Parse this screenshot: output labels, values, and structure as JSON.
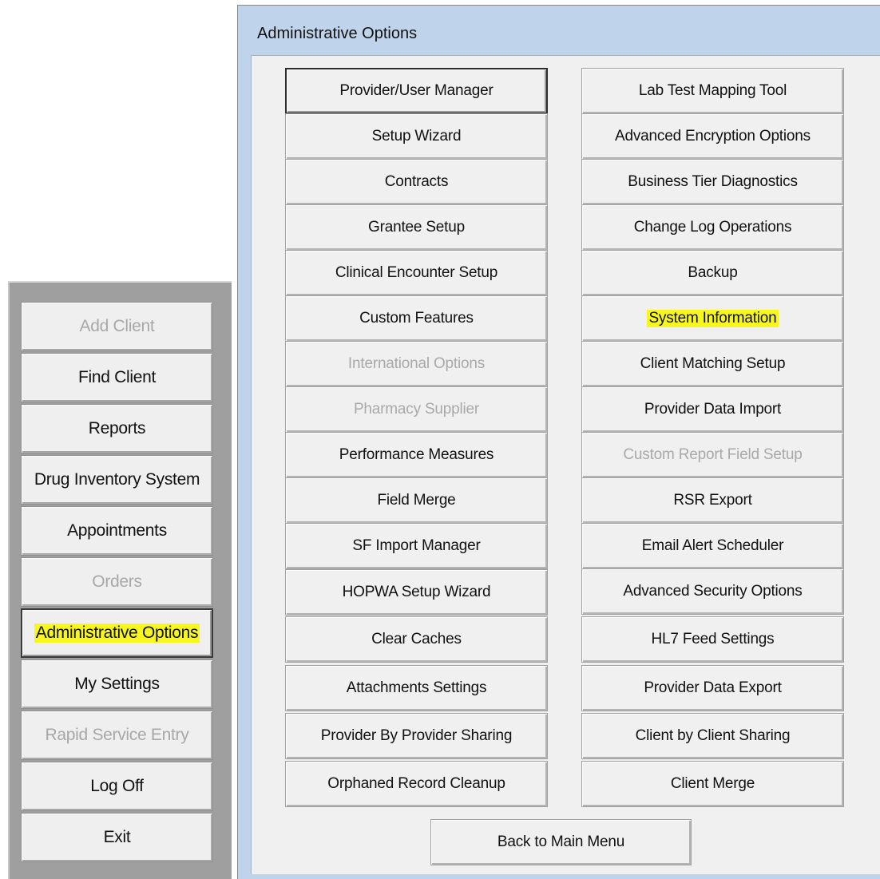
{
  "main_menu": {
    "items": [
      {
        "label": "Add Client",
        "disabled": true
      },
      {
        "label": "Find Client",
        "disabled": false
      },
      {
        "label": "Reports",
        "disabled": false
      },
      {
        "label": "Drug Inventory System",
        "disabled": false
      },
      {
        "label": "Appointments",
        "disabled": false
      },
      {
        "label": "Orders",
        "disabled": true
      },
      {
        "label": "Administrative Options",
        "disabled": false,
        "selected": true,
        "highlighted": true
      },
      {
        "label": "My Settings",
        "disabled": false
      },
      {
        "label": "Rapid Service Entry",
        "disabled": true
      },
      {
        "label": "Log Off",
        "disabled": false
      },
      {
        "label": "Exit",
        "disabled": false
      }
    ]
  },
  "admin_window": {
    "title": "Administrative Options",
    "left_column": [
      {
        "label": "Provider/User Manager",
        "disabled": false,
        "default": true
      },
      {
        "label": "Setup Wizard",
        "disabled": false
      },
      {
        "label": "Contracts",
        "disabled": false
      },
      {
        "label": "Grantee Setup",
        "disabled": false
      },
      {
        "label": "Clinical Encounter Setup",
        "disabled": false
      },
      {
        "label": "Custom Features",
        "disabled": false
      },
      {
        "label": "International Options",
        "disabled": true
      },
      {
        "label": "Pharmacy Supplier",
        "disabled": true
      },
      {
        "label": "Performance Measures",
        "disabled": false
      },
      {
        "label": "Field Merge",
        "disabled": false
      },
      {
        "label": "SF Import Manager",
        "disabled": false
      },
      {
        "label": "HOPWA Setup Wizard",
        "disabled": false
      },
      {
        "label": "Clear Caches",
        "disabled": false
      },
      {
        "label": "Attachments Settings",
        "disabled": false
      },
      {
        "label": "Provider By Provider Sharing",
        "disabled": false
      },
      {
        "label": "Orphaned Record Cleanup",
        "disabled": false
      }
    ],
    "right_column": [
      {
        "label": "Lab Test Mapping Tool",
        "disabled": false
      },
      {
        "label": "Advanced Encryption Options",
        "disabled": false
      },
      {
        "label": "Business Tier Diagnostics",
        "disabled": false
      },
      {
        "label": "Change Log Operations",
        "disabled": false
      },
      {
        "label": "Backup",
        "disabled": false
      },
      {
        "label": "System Information",
        "disabled": false,
        "highlighted": true
      },
      {
        "label": "Client Matching Setup",
        "disabled": false
      },
      {
        "label": "Provider Data Import",
        "disabled": false
      },
      {
        "label": "Custom Report Field Setup",
        "disabled": true
      },
      {
        "label": "RSR Export",
        "disabled": false
      },
      {
        "label": "Email Alert Scheduler",
        "disabled": false
      },
      {
        "label": "Advanced Security Options",
        "disabled": false
      },
      {
        "label": "HL7 Feed Settings",
        "disabled": false
      },
      {
        "label": "Provider Data Export",
        "disabled": false
      },
      {
        "label": "Client by Client Sharing",
        "disabled": false
      },
      {
        "label": "Client Merge",
        "disabled": false
      }
    ],
    "back_button": {
      "label": "Back to Main Menu"
    }
  },
  "colors": {
    "highlight": "#f7f71e",
    "window_frame": "#bfd3ea",
    "button_face": "#f0f0f0",
    "disabled_text": "#a9a9a9"
  }
}
